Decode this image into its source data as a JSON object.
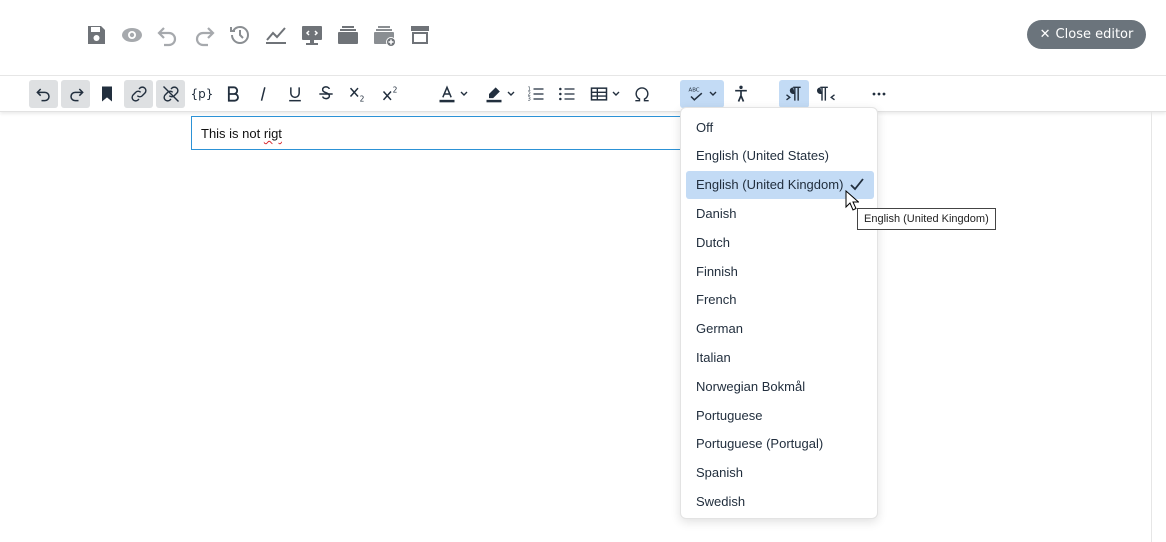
{
  "top_toolbar": {
    "icons": [
      "save-icon",
      "preview-icon",
      "undo-icon",
      "redo-icon",
      "history-icon",
      "stats-icon",
      "screen-icon",
      "stack-icon",
      "add-stack-icon",
      "archive-icon"
    ],
    "close_label": "Close editor"
  },
  "editor_toolbar": {
    "icons": [
      "undo",
      "redo",
      "bookmark",
      "link",
      "unlink",
      "placeholder",
      "bold",
      "italic",
      "underline",
      "strikethrough",
      "subscript",
      "superscript",
      "text-color",
      "highlight-color",
      "ordered-list",
      "bullet-list",
      "table",
      "special-char",
      "spellcheck",
      "accessibility",
      "ltr",
      "rtl",
      "more"
    ],
    "placeholder_text": "{p}"
  },
  "editor": {
    "text_before": "This is not ",
    "misspelled_word": "rigt"
  },
  "spellcheck_menu": {
    "items": [
      {
        "label": "Off",
        "active": false
      },
      {
        "label": "English (United States)",
        "active": false
      },
      {
        "label": "English (United Kingdom)",
        "active": true
      },
      {
        "label": "Danish",
        "active": false
      },
      {
        "label": "Dutch",
        "active": false
      },
      {
        "label": "Finnish",
        "active": false
      },
      {
        "label": "French",
        "active": false
      },
      {
        "label": "German",
        "active": false
      },
      {
        "label": "Italian",
        "active": false
      },
      {
        "label": "Norwegian Bokmål",
        "active": false
      },
      {
        "label": "Portuguese",
        "active": false
      },
      {
        "label": "Portuguese (Portugal)",
        "active": false
      },
      {
        "label": "Spanish",
        "active": false
      },
      {
        "label": "Swedish",
        "active": false
      }
    ]
  },
  "tooltip": {
    "text": "English (United Kingdom)"
  },
  "colors": {
    "accent": "#2c92d6",
    "active_bg": "#c3dbf5",
    "close_button": "#6b747c",
    "icon": "#6f7378"
  }
}
